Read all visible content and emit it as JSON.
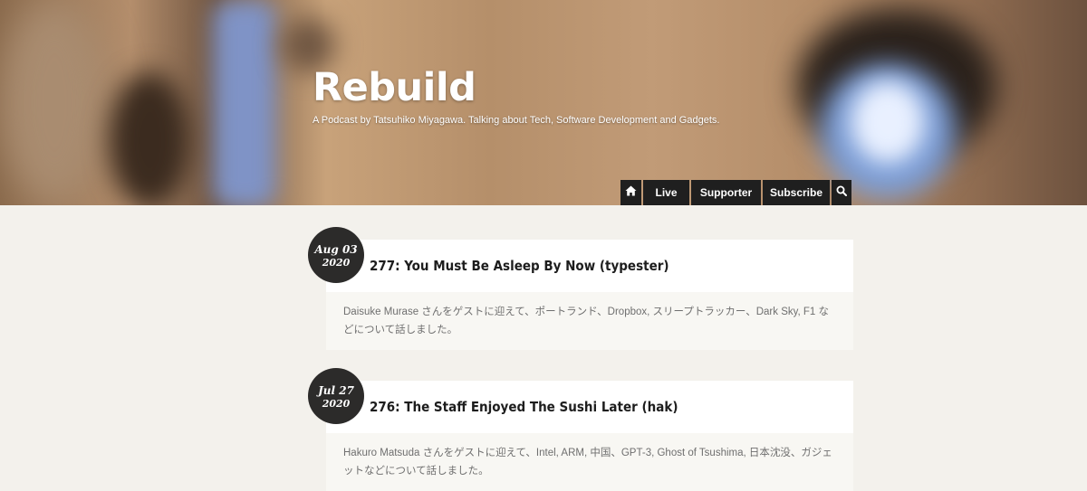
{
  "site": {
    "title": "Rebuild",
    "tagline": "A Podcast by Tatsuhiko Miyagawa. Talking about Tech, Software Development and Gadgets."
  },
  "nav": {
    "home_icon": "home-icon",
    "items": [
      {
        "label": "Live"
      },
      {
        "label": "Supporter"
      },
      {
        "label": "Subscribe"
      }
    ],
    "search_icon": "search-icon"
  },
  "posts": [
    {
      "date": {
        "month_day": "Aug 03",
        "year": "2020"
      },
      "title": "277: You Must Be Asleep By Now (typester)",
      "summary": "Daisuke Murase さんをゲストに迎えて、ポートランド、Dropbox, スリープトラッカー、Dark Sky, F1 などについて話しました。"
    },
    {
      "date": {
        "month_day": "Jul 27",
        "year": "2020"
      },
      "title": "276: The Staff Enjoyed The Sushi Later (hak)",
      "summary": "Hakuro Matsuda さんをゲストに迎えて、Intel, ARM, 中国、GPT-3, Ghost of Tsushima, 日本沈没、ガジェットなどについて話しました。"
    }
  ],
  "colors": {
    "nav_bg": "#1f1f1f",
    "date_circle": "#2c2b2a",
    "page_bg": "#f3f1ec"
  }
}
